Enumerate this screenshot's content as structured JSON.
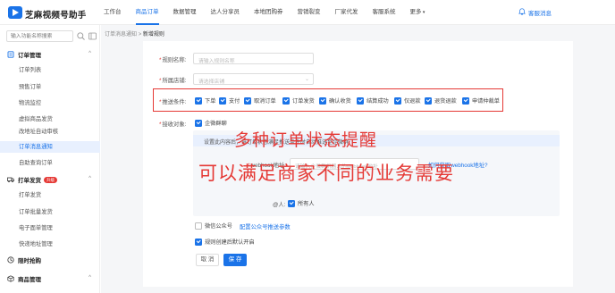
{
  "app": {
    "title": "芝麻视频号助手"
  },
  "nav": {
    "items": [
      "工作台",
      "商品订单",
      "数据管理",
      "达人分享员",
      "本地团购券",
      "营销裂变",
      "厂家代发",
      "客服系统",
      "更多"
    ],
    "active_index": 1,
    "messages": "客服消息"
  },
  "sidebar": {
    "search_placeholder": "输入功能名称搜索",
    "groups": [
      {
        "label": "订单管理",
        "items": [
          "订单列表",
          "预售订单",
          "物流监控",
          "虚拟商品发货",
          "改地址自动审核",
          "订单消息通知",
          "自助查询订单"
        ]
      },
      {
        "label": "打单发货",
        "badge": "升级",
        "items": [
          "打单发货",
          "订单批量发货",
          "电子面单管理",
          "快递地址管理"
        ]
      },
      {
        "label": "限时抢购",
        "items": []
      },
      {
        "label": "商品管理",
        "items": []
      }
    ],
    "active_item": "订单消息通知"
  },
  "breadcrumb": {
    "parent": "订单消息通知",
    "sep": ">",
    "current": "新增规则"
  },
  "form": {
    "rule_name_label": "规则名称:",
    "rule_name_placeholder": "请输入规则名称",
    "shop_label": "所属店铺:",
    "shop_placeholder": "请选择店铺",
    "trigger_label": "推送条件:",
    "trigger_options": [
      {
        "label": "下单",
        "checked": true
      },
      {
        "label": "支付",
        "checked": true
      },
      {
        "label": "取消订单",
        "checked": true
      },
      {
        "label": "订单发货",
        "checked": true
      },
      {
        "label": "确认收货",
        "checked": true
      },
      {
        "label": "结算成功",
        "checked": true
      },
      {
        "label": "仅退款",
        "checked": true
      },
      {
        "label": "退货退款",
        "checked": true
      },
      {
        "label": "申请仲裁单",
        "checked": true
      }
    ],
    "receiver_label": "接收对象:",
    "receiver_option": "企微群聊",
    "info_text": "设置此内容后，当订单状态满足推送条件时自动推送至企微群",
    "webhook_label": "webhook地址:",
    "webhook_placeholder": "请输入企微群机器人的webhook地址",
    "webhook_link": "如何获取webhook地址?",
    "at_label": "@人:",
    "at_option": "所有人",
    "wechat_option": "微信公众号",
    "wechat_link": "配置公众号推送参数",
    "default_option": "规则创建后默认开启",
    "cancel_label": "取 消",
    "save_label": "保 存"
  },
  "overlay": {
    "line1": "多种订单状态提醒",
    "line2": "可以满足商家不同的业务需要"
  },
  "colors": {
    "accent": "#1a73e8",
    "highlight": "#e53935"
  }
}
